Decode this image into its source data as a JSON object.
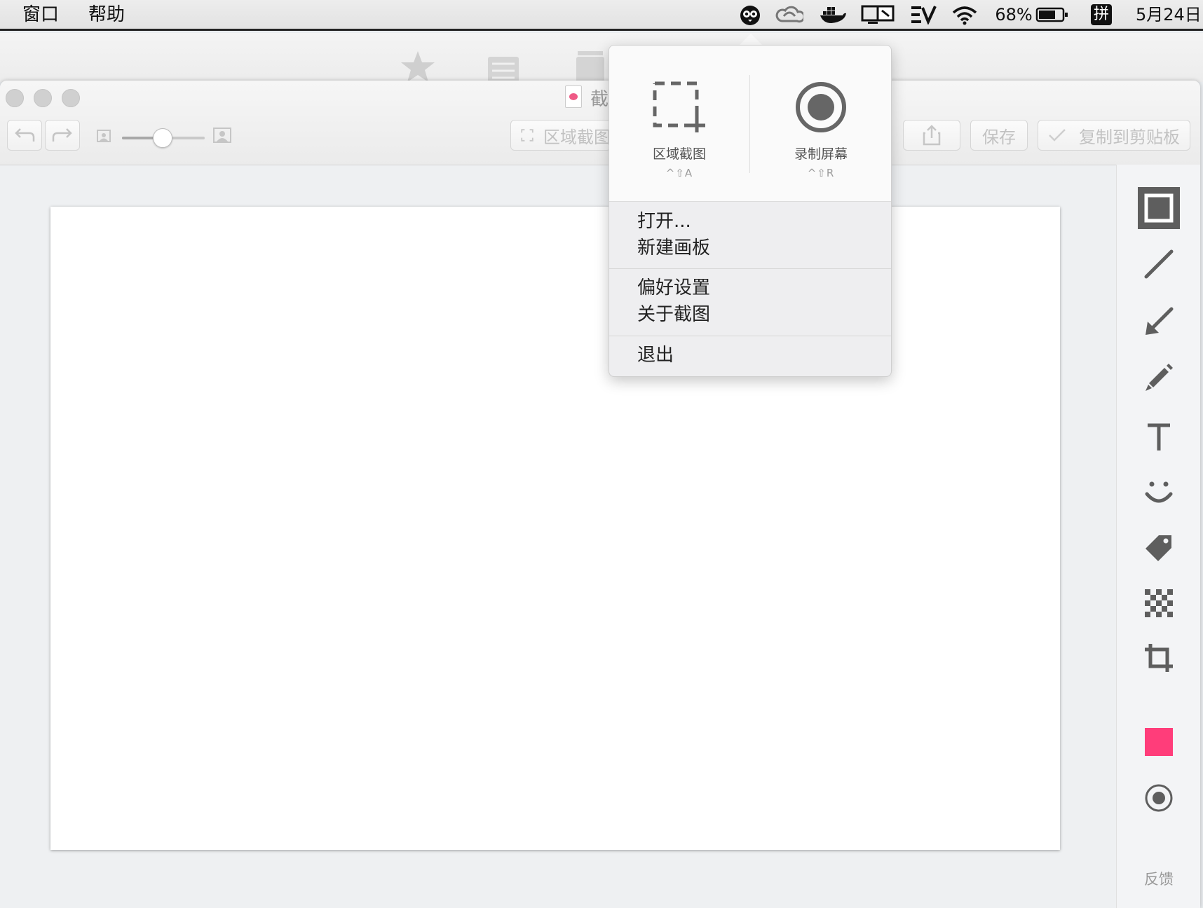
{
  "menubar": {
    "items": [
      "窗口",
      "帮助"
    ],
    "tray": {
      "battery_percent": "68%",
      "input_method": "拼",
      "date": "5月24日"
    }
  },
  "window": {
    "title": "截",
    "toolbar": {
      "region_capture_label": "区域截图",
      "save_label": "保存",
      "copy_label": "复制到剪贴板"
    }
  },
  "popover": {
    "region": {
      "label": "区域截图",
      "shortcut": "^⇧A"
    },
    "record": {
      "label": "录制屏幕",
      "shortcut": "^⇧R"
    },
    "groups": [
      [
        "打开...",
        "新建画板"
      ],
      [
        "偏好设置",
        "关于截图"
      ],
      [
        "退出"
      ]
    ]
  },
  "rail": {
    "color_swatch": "#ff3d7a",
    "feedback_label": "反馈"
  },
  "colors": {
    "accent_pink": "#ff3d7a",
    "icon_gray": "#5e5e5e"
  }
}
